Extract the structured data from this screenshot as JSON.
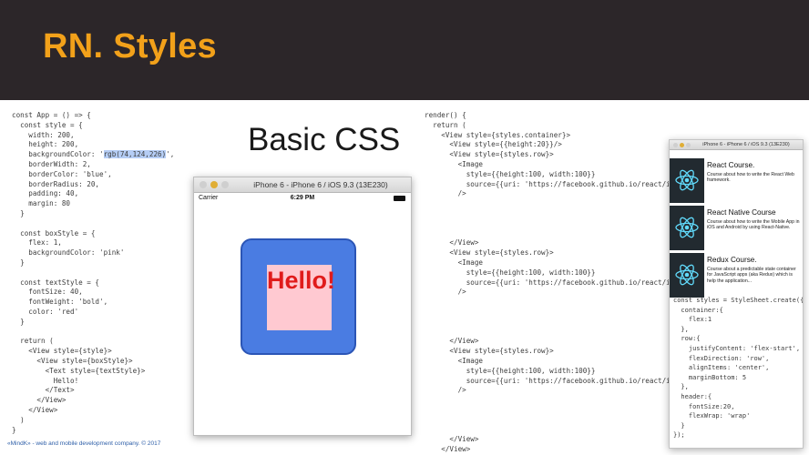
{
  "header": {
    "title": "RN. Styles"
  },
  "slide_heading": "Basic CSS",
  "left_code": [
    "const App = () => {",
    "  const style = {",
    "    width: 200,",
    "    height: 200,",
    "    backgroundColor: 'rgb(74,124,226)',",
    "    borderWidth: 2,",
    "    borderColor: 'blue',",
    "    borderRadius: 20,",
    "    padding: 40,",
    "    margin: 80",
    "  }",
    "",
    "  const boxStyle = {",
    "    flex: 1,",
    "    backgroundColor: 'pink'",
    "  }",
    "",
    "  const textStyle = {",
    "    fontSize: 40,",
    "    fontWeight: 'bold',",
    "    color: 'red'",
    "  }",
    "",
    "  return (",
    "    <View style={style}>",
    "      <View style={boxStyle}>",
    "        <Text style={textStyle}>",
    "          Hello!",
    "        </Text>",
    "      </View>",
    "    </View>",
    "  )",
    "}"
  ],
  "left_code_highlight": "rgb(74,124,226)",
  "simulator1": {
    "window_title": "iPhone 6 - iPhone 6 / iOS 9.3 (13E230)",
    "carrier": "Carrier",
    "time": "6:29 PM",
    "hello_text": "Hello!"
  },
  "right_code": [
    "render() {",
    "  return (",
    "    <View style={styles.container}>",
    "      <View style={{height:20}}/>",
    "      <View style={styles.row}>",
    "        <Image",
    "          style={{height:100, width:100}}",
    "          source={{uri: 'https://facebook.github.io/react/img/logo_og",
    "        />",
    "",
    "",
    "",
    "",
    "      </View>",
    "      <View style={styles.row}>",
    "        <Image",
    "          style={{height:100, width:100}}",
    "          source={{uri: 'https://facebook.github.io/react/img/logo_og",
    "        />",
    "",
    "",
    "",
    "",
    "      </View>",
    "      <View style={styles.row}>",
    "        <Image",
    "          style={{height:100, width:100}}",
    "          source={{uri: 'https://facebook.github.io/react/img/logo_og",
    "        />",
    "",
    "",
    "",
    "",
    "      </View>",
    "    </View>",
    "  );"
  ],
  "simulator2": {
    "window_title": "iPhone 6 - iPhone 6 / iOS 9.3 (13E230)",
    "courses": [
      {
        "title": "React Course.",
        "desc": "Course about how to write the React Web framework."
      },
      {
        "title": "React Native Course",
        "desc": "Course about how to write the Mobile App in iOS and Android by using React-Native."
      },
      {
        "title": "Redux Course.",
        "desc": "Course about a predictable state container for JavaScript apps (aka Redux) which is help the application..."
      }
    ],
    "code": [
      "const styles = StyleSheet.create({",
      "  container:{",
      "    flex:1",
      "  },",
      "  row:{",
      "    justifyContent: 'flex-start',",
      "    flexDirection: 'row',",
      "    alignItems: 'center',",
      "    marginBottom: 5",
      "  },",
      "  header:{",
      "    fontSize:20,",
      "    flexWrap: 'wrap'",
      "  }",
      "});"
    ]
  },
  "footer": "«MindK» -  web and mobile development company. © 2017",
  "colors": {
    "header_bg": "#2c2629",
    "title_orange": "#f2a11a",
    "blue_box": "#4a7ce2",
    "pink_box": "#ffc9d1",
    "hello_red": "#e01b1b"
  }
}
